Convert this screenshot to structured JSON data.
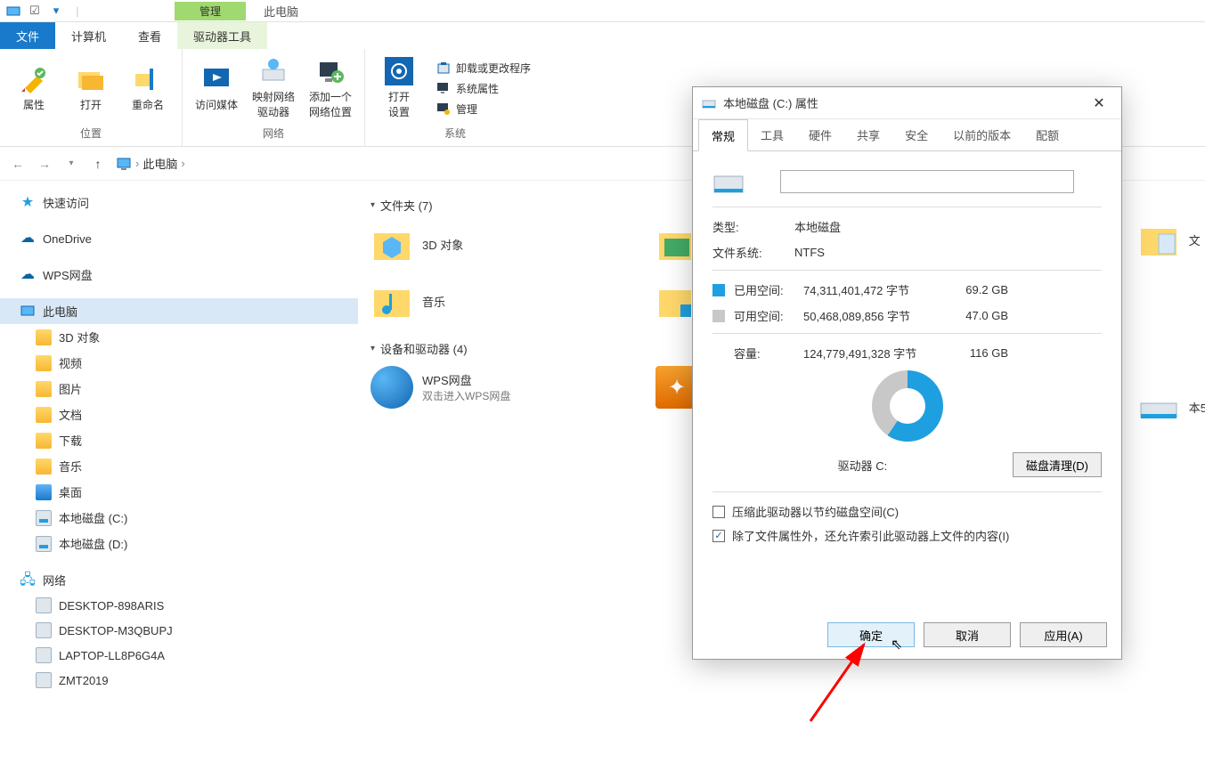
{
  "titlebar": {
    "context_tab": "管理",
    "app_title": "此电脑"
  },
  "menutabs": {
    "file": "文件",
    "computer": "计算机",
    "view": "查看",
    "drive_tools": "驱动器工具"
  },
  "ribbon": {
    "loc": {
      "properties": "属性",
      "open": "打开",
      "rename": "重命名",
      "group": "位置"
    },
    "net": {
      "media": "访问媒体",
      "map": "映射网络\n驱动器",
      "addloc": "添加一个\n网络位置",
      "group": "网络"
    },
    "sys": {
      "open_settings": "打开\n设置",
      "uninstall": "卸载或更改程序",
      "sysprops": "系统属性",
      "manage": "管理",
      "group": "系统"
    }
  },
  "breadcrumb": {
    "root": "此电脑"
  },
  "tree": {
    "quick": "快速访问",
    "onedrive": "OneDrive",
    "wps": "WPS网盘",
    "thispc": "此电脑",
    "obj3d": "3D 对象",
    "video": "视频",
    "pic": "图片",
    "docs": "文档",
    "down": "下载",
    "music": "音乐",
    "desktop": "桌面",
    "cdrive": "本地磁盘 (C:)",
    "ddrive": "本地磁盘 (D:)",
    "network": "网络",
    "pc1": "DESKTOP-898ARIS",
    "pc2": "DESKTOP-M3QBUPJ",
    "pc3": "LAPTOP-LL8P6G4A",
    "pc4": "ZMT2019"
  },
  "content": {
    "folders_hdr": "文件夹 (7)",
    "devices_hdr": "设备和驱动器 (4)",
    "f_3d": "3D 对象",
    "f_music": "音乐",
    "d_wps": "WPS网盘",
    "d_wps_sub": "双击进入WPS网盘"
  },
  "dialog": {
    "title": "本地磁盘 (C:) 属性",
    "tabs": {
      "general": "常规",
      "tools": "工具",
      "hardware": "硬件",
      "sharing": "共享",
      "security": "安全",
      "prev": "以前的版本",
      "quota": "配额"
    },
    "type_lab": "类型:",
    "type_val": "本地磁盘",
    "fs_lab": "文件系统:",
    "fs_val": "NTFS",
    "used_lab": "已用空间:",
    "used_bytes": "74,311,401,472 字节",
    "used_gb": "69.2 GB",
    "free_lab": "可用空间:",
    "free_bytes": "50,468,089,856 字节",
    "free_gb": "47.0 GB",
    "cap_lab": "容量:",
    "cap_bytes": "124,779,491,328 字节",
    "cap_gb": "116 GB",
    "drive_cap": "驱动器 C:",
    "cleanup": "磁盘清理(D)",
    "compress": "压缩此驱动器以节约磁盘空间(C)",
    "index": "除了文件属性外，还允许索引此驱动器上文件的内容(I)",
    "ok": "确定",
    "cancel": "取消",
    "apply": "应用(A)"
  },
  "chart_data": {
    "type": "pie",
    "title": "驱动器 C:",
    "series": [
      {
        "name": "已用空间",
        "value": 74311401472,
        "display": "69.2 GB",
        "color": "#1e9fe0"
      },
      {
        "name": "可用空间",
        "value": 50468089856,
        "display": "47.0 GB",
        "color": "#c8c8c8"
      }
    ],
    "total": {
      "value": 124779491328,
      "display": "116 GB"
    }
  }
}
